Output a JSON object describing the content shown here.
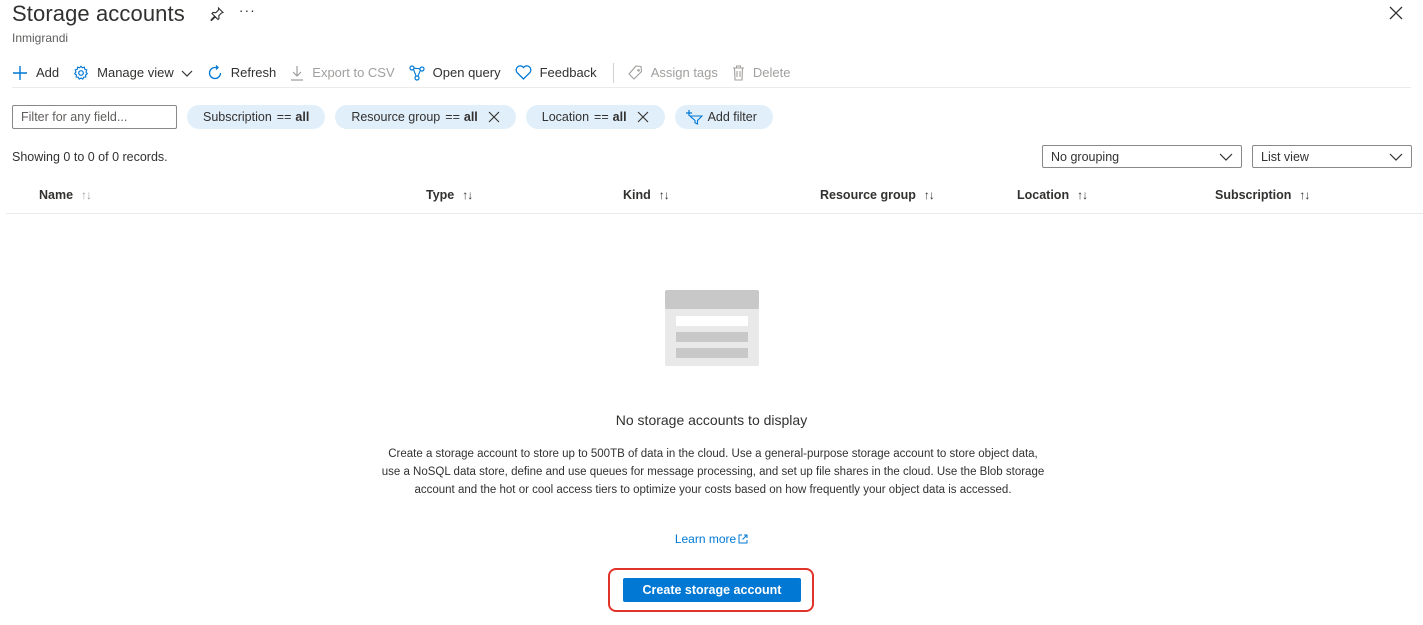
{
  "header": {
    "title": "Storage accounts",
    "subtitle": "Inmigrandi",
    "more_label": "···"
  },
  "toolbar": {
    "items": [
      {
        "label": "Add",
        "icon": "plus-icon",
        "enabled": true
      },
      {
        "label": "Manage view",
        "icon": "gear-icon",
        "enabled": true
      },
      {
        "label": "Refresh",
        "icon": "refresh-icon",
        "enabled": true
      },
      {
        "label": "Export to CSV",
        "icon": "download-icon",
        "enabled": false
      },
      {
        "label": "Open query",
        "icon": "query-icon",
        "enabled": true
      },
      {
        "label": "Feedback",
        "icon": "heart-icon",
        "enabled": true
      },
      {
        "label": "Assign tags",
        "icon": "tag-icon",
        "enabled": false
      },
      {
        "label": "Delete",
        "icon": "trash-icon",
        "enabled": false
      }
    ]
  },
  "filters": {
    "search_placeholder": "Filter for any field...",
    "pills": [
      {
        "field": "Subscription",
        "op": "==",
        "value": "all"
      },
      {
        "field": "Resource group",
        "op": "==",
        "value": "all"
      },
      {
        "field": "Location",
        "op": "==",
        "value": "all"
      }
    ],
    "add_filter_label": "Add filter"
  },
  "records_text": "Showing 0 to 0 of 0 records.",
  "grouping": {
    "selected": "No grouping"
  },
  "view": {
    "selected": "List view"
  },
  "table": {
    "columns": [
      {
        "label": "Name",
        "sort": "↑↓"
      },
      {
        "label": "Type",
        "sort": "↑↓"
      },
      {
        "label": "Kind",
        "sort": "↑↓"
      },
      {
        "label": "Resource group",
        "sort": "↑↓"
      },
      {
        "label": "Location",
        "sort": "↑↓"
      },
      {
        "label": "Subscription",
        "sort": "↑↓"
      }
    ]
  },
  "empty_state": {
    "title": "No storage accounts to display",
    "description": "Create a storage account to store up to 500TB of data in the cloud. Use a general-purpose storage account to store object data, use a NoSQL data store, define and use queues for message processing, and set up file shares in the cloud. Use the Blob storage account and the hot or cool access tiers to optimize your costs based on how frequently your object data is accessed.",
    "learn_more": "Learn more",
    "create_button": "Create storage account"
  },
  "colors": {
    "accent": "#0078d4",
    "highlight": "#e0342a",
    "pill_bg": "#e1effa"
  }
}
